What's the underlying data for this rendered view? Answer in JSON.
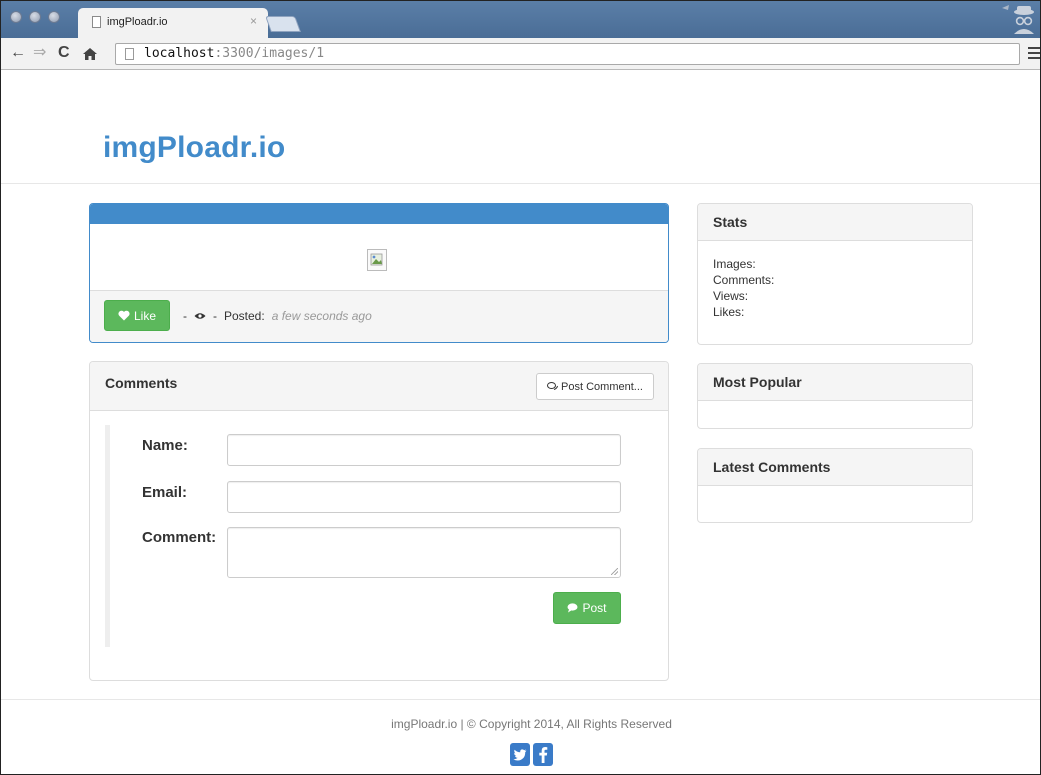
{
  "browser": {
    "tab_title": "imgPloadr.io",
    "tab_close": "×",
    "url_host": "localhost",
    "url_rest": ":3300/images/1"
  },
  "page": {
    "brand": "imgPloadr.io",
    "image": {
      "like_label": "Like",
      "sep1": "-",
      "sep2": "-",
      "posted_label": "Posted:",
      "posted_time": "a few seconds ago"
    },
    "comments": {
      "title": "Comments",
      "post_comment_button": "Post Comment...",
      "form": {
        "name_label": "Name:",
        "email_label": "Email:",
        "comment_label": "Comment:",
        "name_value": "",
        "email_value": "",
        "comment_value": "",
        "post_button": "Post"
      }
    },
    "sidebar": {
      "stats_title": "Stats",
      "stats": [
        "Images:",
        "Comments:",
        "Views:",
        "Likes:"
      ],
      "popular_title": "Most Popular",
      "latest_title": "Latest Comments"
    },
    "footer": {
      "text": "imgPloadr.io | © Copyright 2014, All Rights Reserved"
    }
  },
  "colors": {
    "brand_blue": "#428bca",
    "success_green": "#5cb85c",
    "social_blue": "#3a7bc8"
  },
  "icons": [
    "page-icon",
    "back-arrow-icon",
    "forward-arrow-icon",
    "reload-icon",
    "home-icon",
    "menu-icon",
    "incognito-icon",
    "heart-icon",
    "eye-icon",
    "comments-icon",
    "comment-icon",
    "broken-image-icon",
    "twitter-icon",
    "facebook-icon"
  ]
}
